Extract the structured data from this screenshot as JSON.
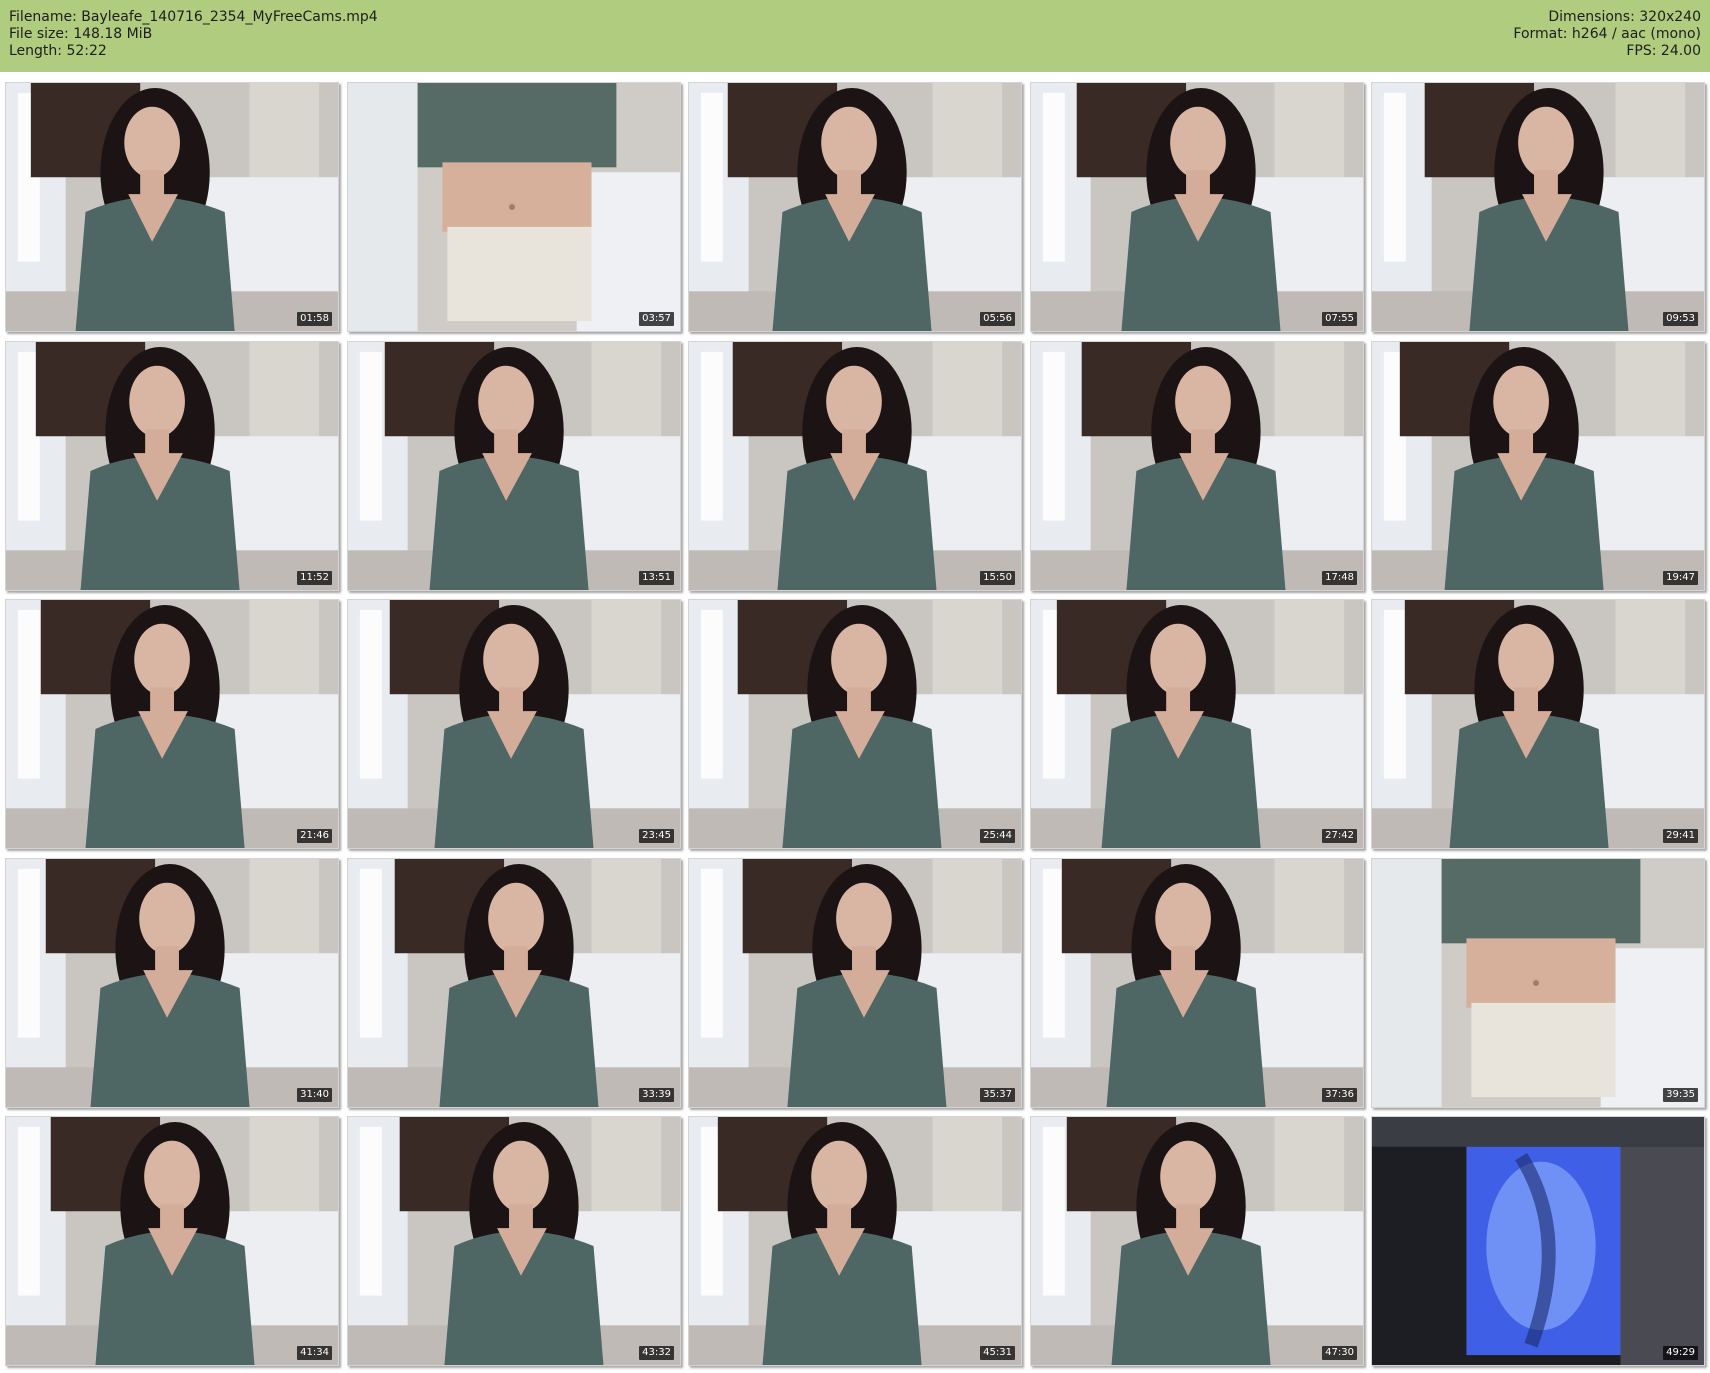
{
  "header": {
    "filename_line": "Filename: Bayleafe_140716_2354_MyFreeCams.mp4",
    "filesize_line": "File size: 148.18 MiB",
    "length_line": "Length: 52:22",
    "dimensions_line": "Dimensions: 320x240",
    "format_line": "Format: h264 / aac (mono)",
    "fps_line": "FPS: 24.00"
  },
  "colors": {
    "header_bg": "#b0cc7e",
    "page_bg": "#ffffff",
    "timestamp_bg": "#000000",
    "timestamp_text": "#ffffff"
  },
  "thumbnails": [
    {
      "time": "01:58",
      "scene": "room"
    },
    {
      "time": "03:57",
      "scene": "closeup-body"
    },
    {
      "time": "05:56",
      "scene": "room"
    },
    {
      "time": "07:55",
      "scene": "room"
    },
    {
      "time": "09:53",
      "scene": "room"
    },
    {
      "time": "11:52",
      "scene": "room"
    },
    {
      "time": "13:51",
      "scene": "room"
    },
    {
      "time": "15:50",
      "scene": "room"
    },
    {
      "time": "17:48",
      "scene": "room"
    },
    {
      "time": "19:47",
      "scene": "room"
    },
    {
      "time": "21:46",
      "scene": "room"
    },
    {
      "time": "23:45",
      "scene": "room"
    },
    {
      "time": "25:44",
      "scene": "room"
    },
    {
      "time": "27:42",
      "scene": "room"
    },
    {
      "time": "29:41",
      "scene": "room"
    },
    {
      "time": "31:40",
      "scene": "room"
    },
    {
      "time": "33:39",
      "scene": "room"
    },
    {
      "time": "35:37",
      "scene": "room"
    },
    {
      "time": "37:36",
      "scene": "room"
    },
    {
      "time": "39:35",
      "scene": "closeup-body"
    },
    {
      "time": "41:34",
      "scene": "room"
    },
    {
      "time": "43:32",
      "scene": "room"
    },
    {
      "time": "45:31",
      "scene": "room"
    },
    {
      "time": "47:30",
      "scene": "room"
    },
    {
      "time": "49:29",
      "scene": "blue-screen"
    }
  ]
}
